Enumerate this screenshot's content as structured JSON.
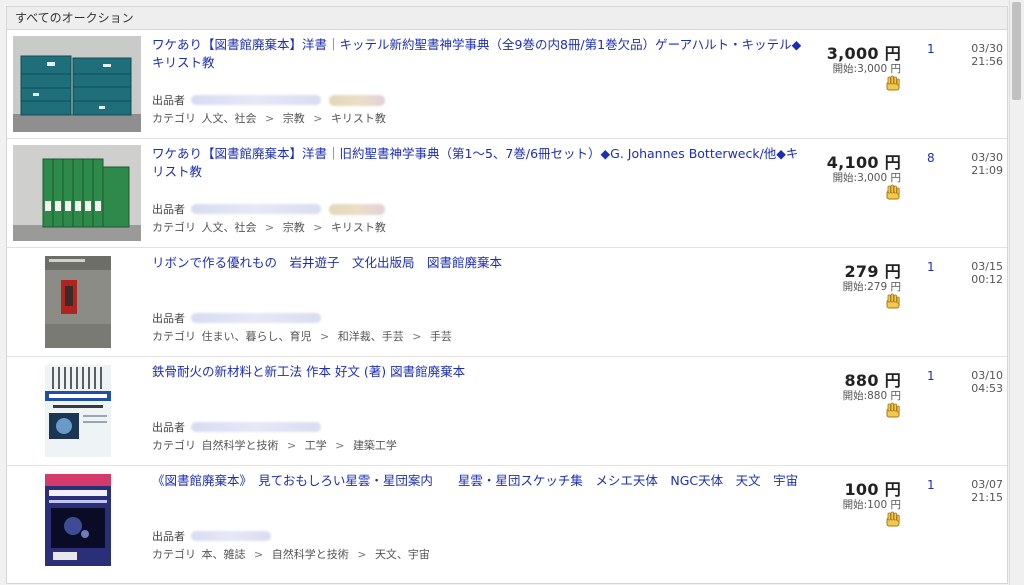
{
  "header": {
    "title": "すべてのオークション"
  },
  "seller_label": "出品者",
  "category_label": "カテゴリ",
  "yen": "円",
  "items": [
    {
      "title": "ワケあり【図書館廃棄本】洋書｜キッテル新約聖書神学事典（全9巻の内8冊/第1巻欠品）ゲーアハルト・キッテル◆キリスト教",
      "price": "3,000",
      "start": "開始:3,000 円",
      "bids": "1",
      "date": "03/30",
      "time": "21:56",
      "category": [
        "人文、社会",
        "宗教",
        "キリスト教"
      ],
      "image": "teal-boxed-volumes"
    },
    {
      "title": "ワケあり【図書館廃棄本】洋書｜旧約聖書神学事典（第1～5、7巻/6冊セット）◆G. Johannes Botterweck/他◆キリスト教",
      "price": "4,100",
      "start": "開始:3,000 円",
      "bids": "8",
      "date": "03/30",
      "time": "21:09",
      "category": [
        "人文、社会",
        "宗教",
        "キリスト教"
      ],
      "image": "green-volumes"
    },
    {
      "title": "リボンで作る優れもの　岩井遊子　文化出版局　図書館廃棄本",
      "price": "279",
      "start": "開始:279 円",
      "bids": "1",
      "date": "03/15",
      "time": "00:12",
      "category": [
        "住まい、暮らし、育児",
        "和洋裁、手芸",
        "手芸"
      ],
      "image": "ribbon-book"
    },
    {
      "title": "鉄骨耐火の新材料と新工法 作本 好文 (著) 図書館廃棄本",
      "price": "880",
      "start": "開始:880 円",
      "bids": "1",
      "date": "03/10",
      "time": "04:53",
      "category": [
        "自然科学と技術",
        "工学",
        "建築工学"
      ],
      "image": "steel-book"
    },
    {
      "title": "《図書館廃棄本》　見ておもしろい星雲・星団案内　　星雲・星団スケッチ集　メシエ天体　NGC天体　天文　宇宙",
      "price": "100",
      "start": "開始:100 円",
      "bids": "1",
      "date": "03/07",
      "time": "21:15",
      "category": [
        "本、雑誌",
        "自然科学と技術",
        "天文、宇宙"
      ],
      "image": "nebula-book"
    }
  ]
}
